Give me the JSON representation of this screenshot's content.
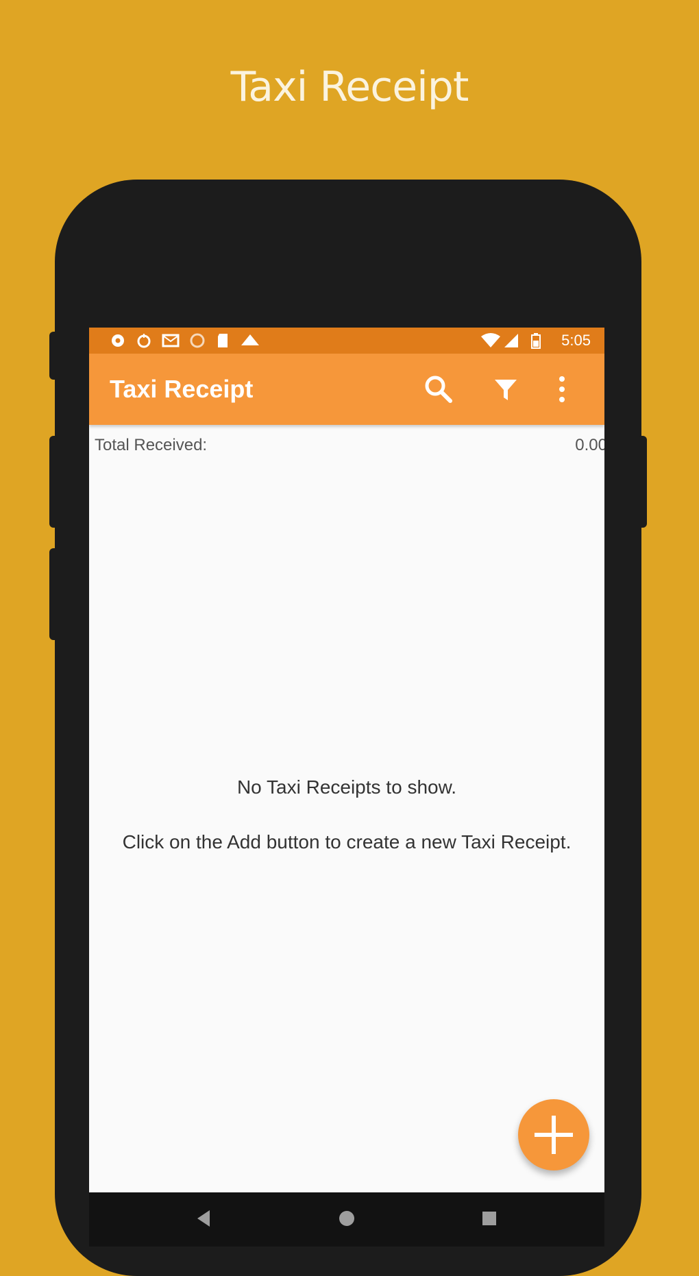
{
  "promo": {
    "title": "Taxi Receipt"
  },
  "status_bar": {
    "time": "5:05",
    "icons": [
      "settings-icon",
      "timer-icon",
      "mail-icon",
      "circle-icon",
      "sd-card-icon",
      "warning-icon",
      "wifi-icon",
      "signal-icon",
      "battery-icon"
    ]
  },
  "app_bar": {
    "title": "Taxi Receipt",
    "actions": [
      "search-icon",
      "filter-icon",
      "more-vert-icon"
    ]
  },
  "summary": {
    "total_label": "Total Received:",
    "total_value": "0.00"
  },
  "empty_state": {
    "line1": "No Taxi Receipts to show.",
    "line2": "Click on the Add button to create a new Taxi Receipt."
  },
  "fab": {
    "icon": "plus-icon"
  },
  "navigation": {
    "buttons": [
      "back-icon",
      "home-icon",
      "recents-icon"
    ]
  },
  "colors": {
    "background": "#DFA524",
    "status_bar": "#E07C1A",
    "app_bar": "#F6973A",
    "accent": "#F6973A",
    "phone_body": "#1C1C1C"
  }
}
